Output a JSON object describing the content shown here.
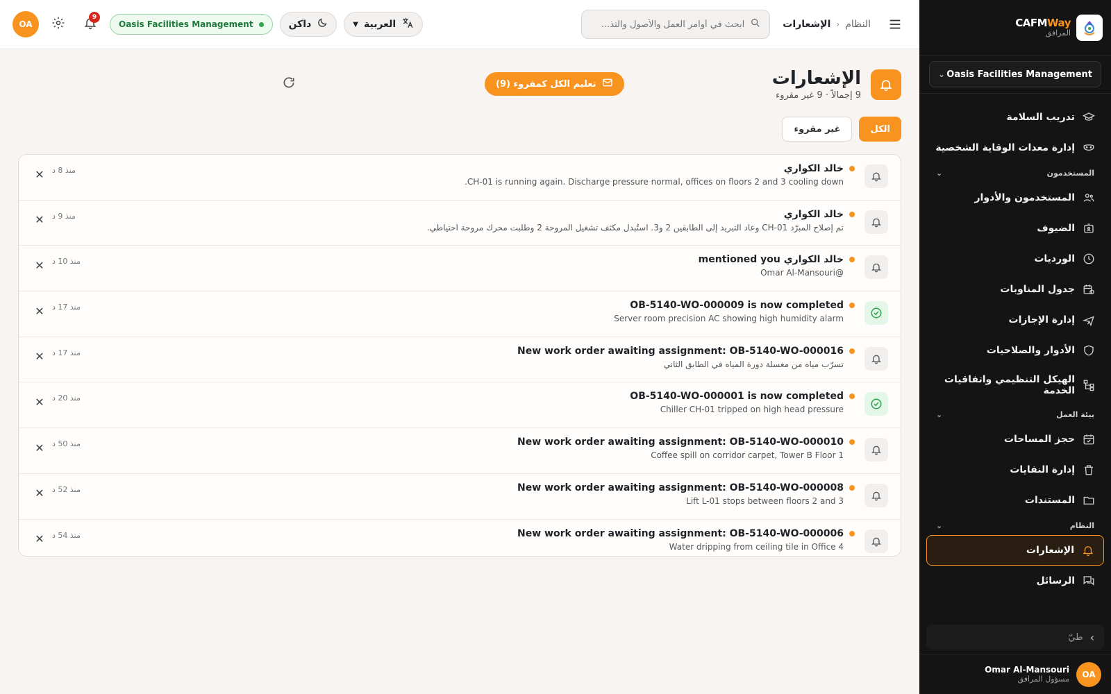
{
  "brand": {
    "name_a": "CAFM",
    "name_b": "Way",
    "subtitle": "المرافق"
  },
  "sidebar": {
    "org_select": "Oasis Facilities Management",
    "items_top": [
      {
        "label": "تدريب السلامة",
        "icon": "graduation-cap-icon"
      },
      {
        "label": "إدارة معدات الوقاية الشخصية",
        "icon": "mask-icon"
      }
    ],
    "section_users": "المستخدمون",
    "items_users": [
      {
        "label": "المستخدمون والأدوار",
        "icon": "users-icon"
      },
      {
        "label": "الضيوف",
        "icon": "guest-icon"
      },
      {
        "label": "الورديات",
        "icon": "clock-icon"
      },
      {
        "label": "جدول المناوبات",
        "icon": "calendar-clock-icon"
      },
      {
        "label": "إدارة الإجازات",
        "icon": "plane-icon"
      },
      {
        "label": "الأدوار والصلاحيات",
        "icon": "shield-icon"
      },
      {
        "label": "الهيكل التنظيمي واتفاقيات الخدمة",
        "icon": "org-chart-icon"
      }
    ],
    "section_workplace": "بيئة العمل",
    "items_workplace": [
      {
        "label": "حجز المساحات",
        "icon": "calendar-check-icon"
      },
      {
        "label": "إدارة النفايات",
        "icon": "trash-icon"
      },
      {
        "label": "المستندات",
        "icon": "folder-icon"
      }
    ],
    "section_system": "النظام",
    "items_system": [
      {
        "label": "الإشعارات",
        "icon": "bell-icon",
        "active": true
      },
      {
        "label": "الرسائل",
        "icon": "messages-icon"
      }
    ],
    "collapse_label": "طيّ",
    "user": {
      "initials": "OA",
      "name": "Omar Al-Mansouri",
      "role": "مسؤول المرافق"
    }
  },
  "header": {
    "breadcrumb_root": "النظام",
    "breadcrumb_current": "الإشعارات",
    "search_placeholder": "ابحث في أوامر العمل والأصول والتذ...",
    "language": "العربية",
    "theme": "داكن",
    "org_pill": "Oasis Facilities Management",
    "notif_count": "9",
    "avatar_initials": "OA"
  },
  "page": {
    "title": "الإشعارات",
    "subtitle": "9 إجمالاً · 9 غير مقروء",
    "mark_all_label": "تعليم الكل كمقروء (9)",
    "tab_all": "الكل",
    "tab_unread": "غير مقروء"
  },
  "notifications": [
    {
      "title": "خالد الكواري",
      "message": "CH-01 is running again. Discharge pressure normal, offices on floors 2 and 3 cooling down.",
      "time": "منذ 8 د",
      "icon": "bell-icon",
      "type": "bell"
    },
    {
      "title": "خالد الكواري",
      "message": "تم إصلاح المبرّد CH-01 وعاد التبريد إلى الطابقين 2 و3. استُبدل مكثف تشغيل المروحة 2 وطلبت محرك مروحة احتياطي.",
      "time": "منذ 9 د",
      "icon": "bell-icon",
      "type": "bell"
    },
    {
      "title": "خالد الكواري mentioned you",
      "message": "@Omar Al-Mansouri",
      "time": "منذ 10 د",
      "icon": "bell-icon",
      "type": "bell"
    },
    {
      "title": "OB-5140-WO-000009 is now completed",
      "message": "Server room precision AC showing high humidity alarm",
      "time": "منذ 17 د",
      "icon": "check-circle-icon",
      "type": "ok"
    },
    {
      "title": "New work order awaiting assignment: OB-5140-WO-000016",
      "message": "تسرّب مياه من مغسلة دورة المياه في الطابق الثاني",
      "time": "منذ 17 د",
      "icon": "bell-icon",
      "type": "bell"
    },
    {
      "title": "OB-5140-WO-000001 is now completed",
      "message": "Chiller CH-01 tripped on high head pressure",
      "time": "منذ 20 د",
      "icon": "check-circle-icon",
      "type": "ok"
    },
    {
      "title": "New work order awaiting assignment: OB-5140-WO-000010",
      "message": "Coffee spill on corridor carpet, Tower B Floor 1",
      "time": "منذ 50 د",
      "icon": "bell-icon",
      "type": "bell"
    },
    {
      "title": "New work order awaiting assignment: OB-5140-WO-000008",
      "message": "Lift L-01 stops between floors 2 and 3",
      "time": "منذ 52 د",
      "icon": "bell-icon",
      "type": "bell"
    },
    {
      "title": "New work order awaiting assignment: OB-5140-WO-000006",
      "message": "Water dripping from ceiling tile in Office 4",
      "time": "منذ 54 د",
      "icon": "bell-icon",
      "type": "bell"
    }
  ],
  "colors": {
    "accent": "#f7931e",
    "sidebar_bg": "#141414",
    "success": "#2ea44f",
    "danger": "#d7261e"
  }
}
